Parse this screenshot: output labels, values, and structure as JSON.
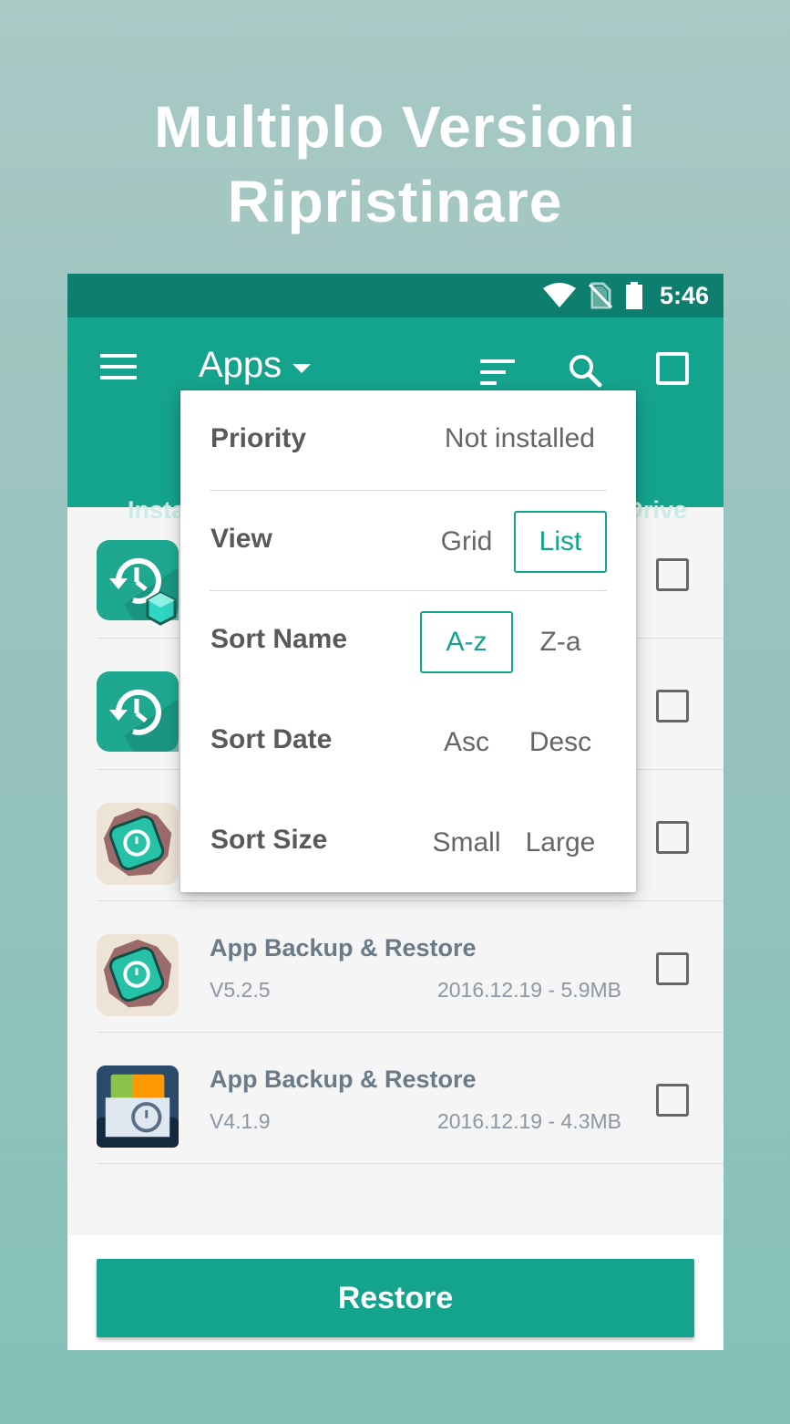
{
  "promo": {
    "title_line1": "Multiplo Versioni",
    "title_line2": "Ripristinare"
  },
  "status_bar": {
    "time": "5:46",
    "icons": [
      "wifi-icon",
      "no-sim-icon",
      "battery-icon"
    ]
  },
  "app_bar": {
    "title": "Apps",
    "icons": [
      "menu-icon",
      "dropdown-caret-icon",
      "sort-icon",
      "search-icon",
      "select-all-checkbox"
    ],
    "tabs": [
      {
        "label": "Insta"
      },
      {
        "label": "Drive"
      }
    ]
  },
  "popup": {
    "priority": {
      "label": "Priority",
      "value": "Not installed"
    },
    "view": {
      "label": "View",
      "options": [
        "Grid",
        "List"
      ],
      "selected": "List"
    },
    "sort_name": {
      "label": "Sort Name",
      "options": [
        "A-z",
        "Z-a"
      ],
      "selected": "A-z"
    },
    "sort_date": {
      "label": "Sort Date",
      "options": [
        "Asc",
        "Desc"
      ],
      "selected": ""
    },
    "sort_size": {
      "label": "Sort Size",
      "options": [
        "Small",
        "Large"
      ],
      "selected": ""
    }
  },
  "list": {
    "rows": [
      {
        "name": "",
        "version": "",
        "meta": "",
        "icon": "app-backup-restore-icon"
      },
      {
        "name": "",
        "version": "",
        "meta": "",
        "icon": "app-backup-restore-icon"
      },
      {
        "name": "",
        "version": "",
        "meta": "",
        "icon": "app-backup-restore-badge-icon"
      },
      {
        "name": "App Backup & Restore",
        "version": "V5.2.5",
        "meta": "2016.12.19 - 5.9MB",
        "icon": "app-backup-restore-badge-icon"
      },
      {
        "name": "App Backup & Restore",
        "version": "V4.1.9",
        "meta": "2016.12.19 - 4.3MB",
        "icon": "app-backup-folder-icon"
      }
    ]
  },
  "restore_button": {
    "label": "Restore"
  },
  "colors": {
    "primary": "#14a38d",
    "status_bar": "#0e7f6f",
    "background_top": "#a9c9c5",
    "background_bottom": "#84c1b9"
  }
}
